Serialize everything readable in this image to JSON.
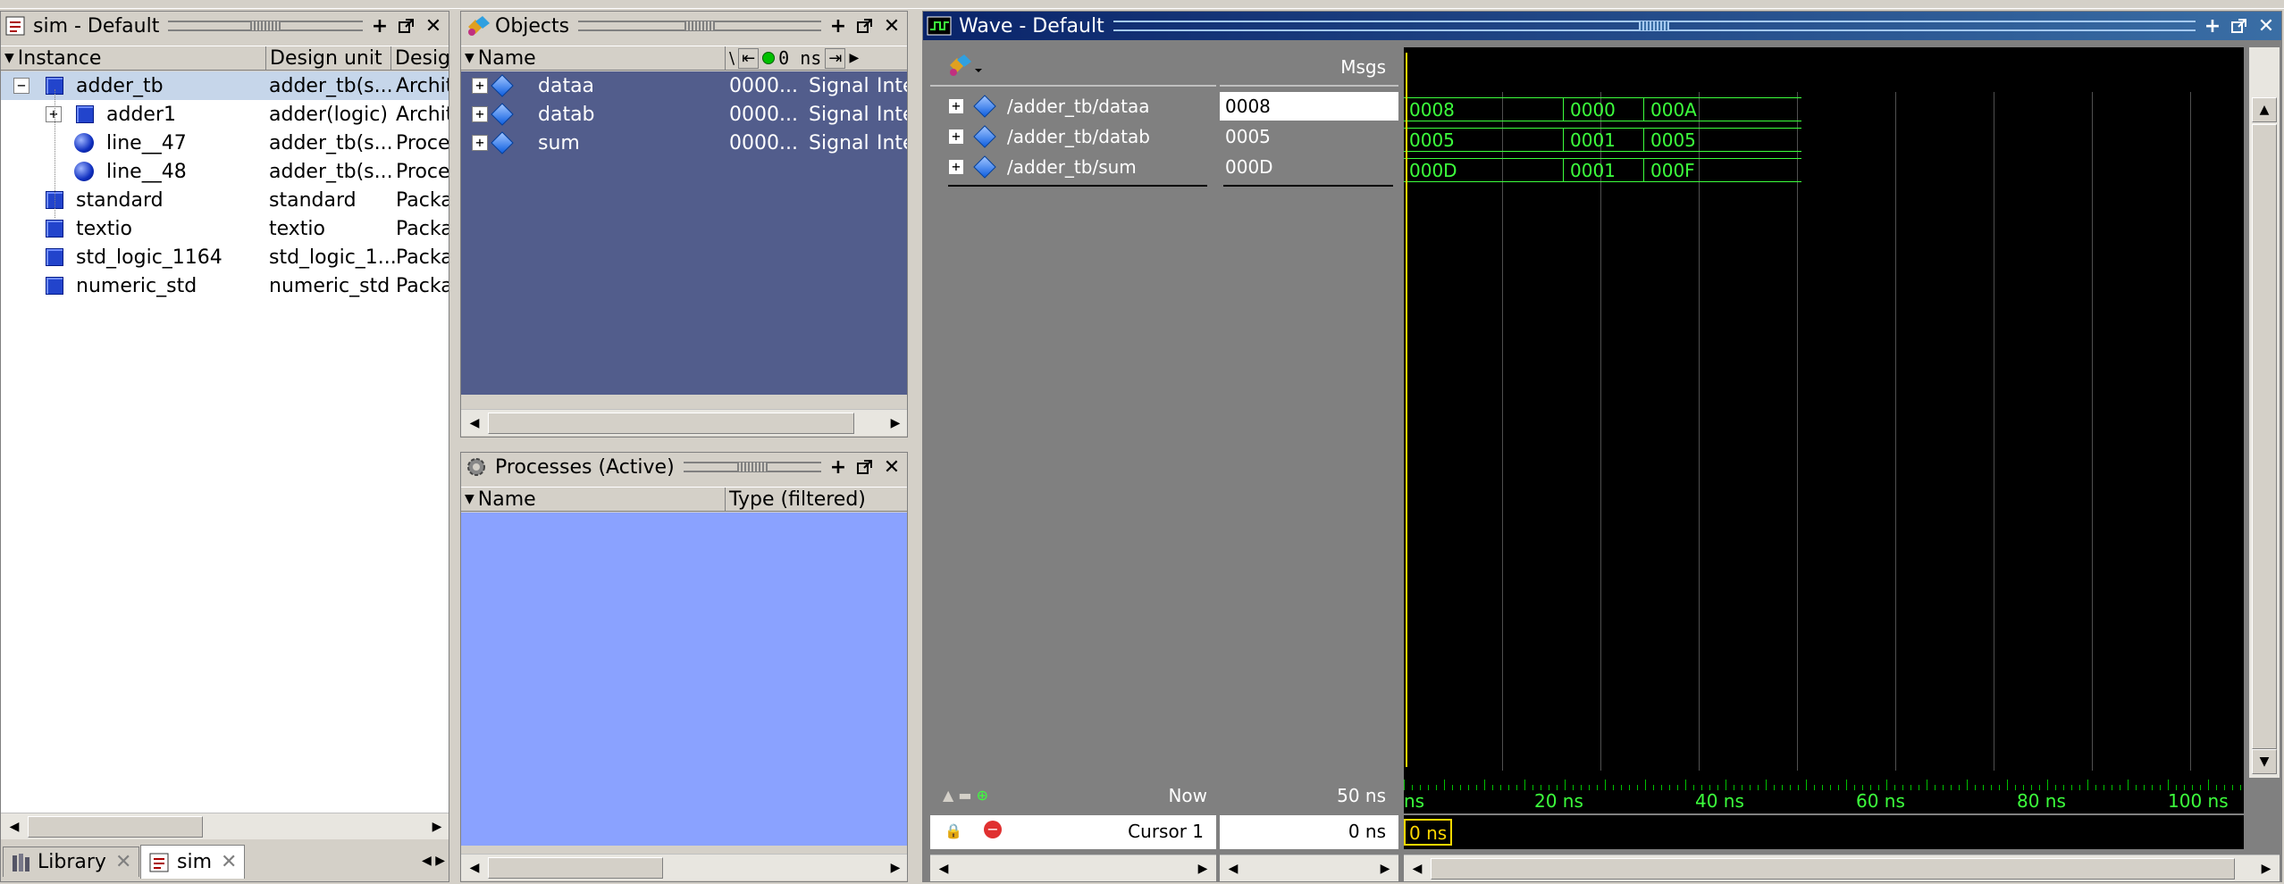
{
  "sim_pane": {
    "title": "sim - Default",
    "columns": [
      "Instance",
      "Design unit",
      "Desig"
    ],
    "rows": [
      {
        "instance": "adder_tb",
        "unit": "adder_tb(s...",
        "type": "Archit",
        "icon": "square"
      },
      {
        "instance": "adder1",
        "unit": "adder(logic)",
        "type": "Archit",
        "icon": "square"
      },
      {
        "instance": "line__47",
        "unit": "adder_tb(s...",
        "type": "Proce",
        "icon": "ball"
      },
      {
        "instance": "line__48",
        "unit": "adder_tb(s...",
        "type": "Proce",
        "icon": "ball"
      },
      {
        "instance": "standard",
        "unit": "standard",
        "type": "Packa",
        "icon": "square"
      },
      {
        "instance": "textio",
        "unit": "textio",
        "type": "Packa",
        "icon": "square"
      },
      {
        "instance": "std_logic_1164",
        "unit": "std_logic_1...",
        "type": "Packa",
        "icon": "square"
      },
      {
        "instance": "numeric_std",
        "unit": "numeric_std",
        "type": "Packa",
        "icon": "square"
      }
    ],
    "tabs": [
      "Library",
      "sim"
    ]
  },
  "objects_pane": {
    "title": "Objects",
    "col_name": "Name",
    "time_value": "0 ns",
    "rows": [
      {
        "name": "dataa",
        "value": "0000...",
        "kind": "Signal",
        "mode": "Inte"
      },
      {
        "name": "datab",
        "value": "0000...",
        "kind": "Signal",
        "mode": "Inte"
      },
      {
        "name": "sum",
        "value": "0000...",
        "kind": "Signal",
        "mode": "Inte"
      }
    ]
  },
  "processes_pane": {
    "title": "Processes (Active)",
    "col_name": "Name",
    "col_type": "Type (filtered)"
  },
  "wave_pane": {
    "title": "Wave - Default",
    "msgs_label": "Msgs",
    "signals": [
      {
        "path": "/adder_tb/dataa",
        "value": "0008",
        "segments": [
          "0008",
          "0000",
          "000A"
        ]
      },
      {
        "path": "/adder_tb/datab",
        "value": "0005",
        "segments": [
          "0005",
          "0001",
          "0005"
        ]
      },
      {
        "path": "/adder_tb/sum",
        "value": "000D",
        "segments": [
          "000D",
          "0001",
          "000F"
        ]
      }
    ],
    "now_label": "Now",
    "now_value": "50 ns",
    "cursor_label": "Cursor 1",
    "cursor_value": "0 ns",
    "cursor_box": "0 ns",
    "axis_labels": [
      "ns",
      "20 ns",
      "40 ns",
      "60 ns",
      "80 ns",
      "100 ns"
    ],
    "colors": {
      "signal": "#3cff3c",
      "cursor": "#ffd700",
      "background": "#000000",
      "title": "#0a246a"
    }
  }
}
